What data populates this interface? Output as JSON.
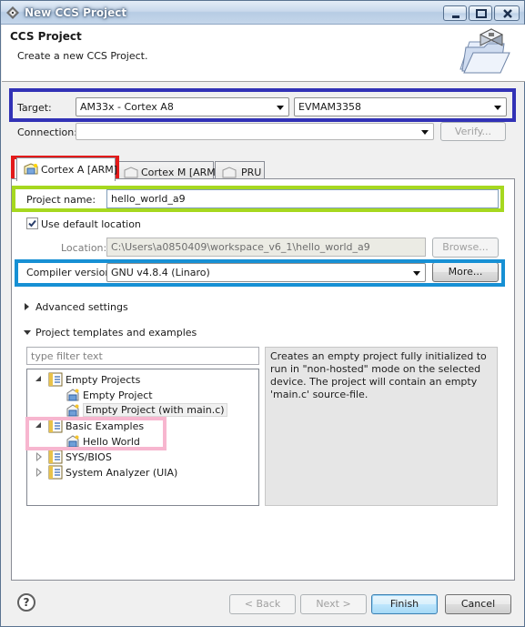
{
  "window": {
    "title": "New CCS Project"
  },
  "banner": {
    "title": "CCS Project",
    "description": "Create a new CCS Project."
  },
  "target": {
    "label": "Target:",
    "device_family": "AM33x - Cortex A8",
    "board": "EVMAM3358"
  },
  "connection": {
    "label": "Connection:",
    "value": "",
    "verify_label": "Verify..."
  },
  "tabs": [
    {
      "label": "Cortex A [ARM]",
      "active": true
    },
    {
      "label": "Cortex M [ARM]",
      "active": false
    },
    {
      "label": "PRU",
      "active": false
    }
  ],
  "project": {
    "name_label": "Project name:",
    "name_value": "hello_world_a9",
    "use_default_location_label": "Use default location",
    "use_default_location_checked": true,
    "location_label": "Location:",
    "location_value": "C:\\Users\\a0850409\\workspace_v6_1\\hello_world_a9",
    "browse_label": "Browse...",
    "compiler_label": "Compiler version:",
    "compiler_value": "GNU v4.8.4 (Linaro)",
    "more_label": "More..."
  },
  "sections": {
    "advanced": "Advanced settings",
    "templates": "Project templates and examples"
  },
  "templates": {
    "filter_placeholder": "type filter text",
    "tree": [
      {
        "label": "Empty Projects",
        "level": 0,
        "expanded": true
      },
      {
        "label": "Empty Project",
        "level": 1
      },
      {
        "label": "Empty Project (with main.c)",
        "level": 1,
        "selected": true
      },
      {
        "label": "Basic Examples",
        "level": 0,
        "expanded": true
      },
      {
        "label": "Hello World",
        "level": 1
      },
      {
        "label": "SYS/BIOS",
        "level": 0,
        "expanded": false
      },
      {
        "label": "System Analyzer (UIA)",
        "level": 0,
        "expanded": false
      }
    ],
    "description": "Creates an empty project fully initialized to run in \"non-hosted\" mode on the selected device. The project will contain an empty 'main.c' source-file."
  },
  "footer": {
    "help": "?",
    "back_label": "< Back",
    "next_label": "Next >",
    "finish_label": "Finish",
    "cancel_label": "Cancel"
  },
  "colors": {
    "highlight_target": "#3232b6",
    "highlight_tab": "#e31a1a",
    "highlight_project_name": "#a6d81f",
    "highlight_compiler": "#1790d4",
    "highlight_basic_examples": "#f7b6cf"
  }
}
